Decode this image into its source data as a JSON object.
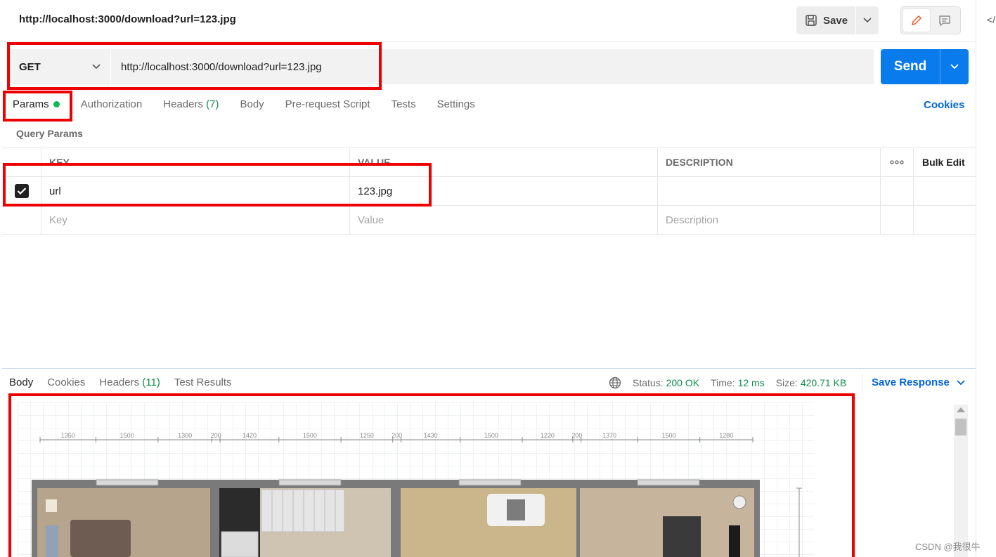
{
  "header": {
    "title": "http://localhost:3000/download?url=123.jpg",
    "save_label": "Save"
  },
  "request": {
    "method": "GET",
    "url": "http://localhost:3000/download?url=123.jpg",
    "send_label": "Send"
  },
  "tabs": {
    "params": "Params",
    "authorization": "Authorization",
    "headers": "Headers",
    "headers_count": "(7)",
    "body": "Body",
    "prerequest": "Pre-request Script",
    "tests": "Tests",
    "settings": "Settings",
    "cookies": "Cookies"
  },
  "query_params": {
    "title": "Query Params",
    "columns": {
      "key": "KEY",
      "value": "VALUE",
      "description": "DESCRIPTION"
    },
    "more": "ooo",
    "bulk_edit": "Bulk Edit",
    "rows": [
      {
        "checked": true,
        "key": "url",
        "value": "123.jpg",
        "description": ""
      }
    ],
    "placeholders": {
      "key": "Key",
      "value": "Value",
      "description": "Description"
    }
  },
  "response": {
    "tabs": {
      "body": "Body",
      "cookies": "Cookies",
      "headers": "Headers",
      "headers_count": "(11)",
      "test_results": "Test Results"
    },
    "status_label": "Status:",
    "status": "200 OK",
    "time_label": "Time:",
    "time": "12 ms",
    "size_label": "Size:",
    "size": "420.71 KB",
    "save_response": "Save Response"
  },
  "floorplan": {
    "dims": [
      "1350",
      "1500",
      "1300",
      "200",
      "1420",
      "1500",
      "1250",
      "200",
      "1430",
      "1500",
      "1220",
      "200",
      "1370",
      "1500",
      "1280"
    ]
  },
  "watermark": "CSDN @我很牛",
  "colors": {
    "accent": "#097bed",
    "link": "#0265d2",
    "success": "#0f8e4d",
    "annotation": "#ee0000"
  }
}
